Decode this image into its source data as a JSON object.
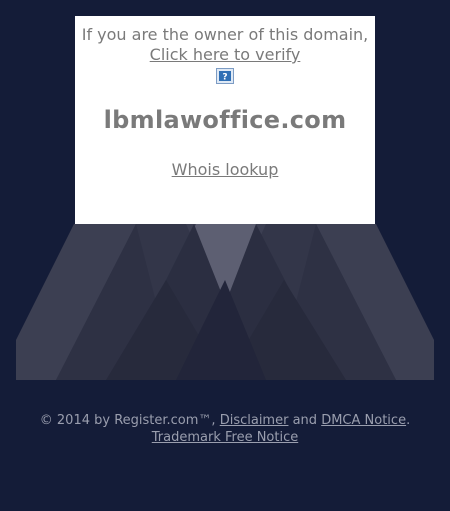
{
  "panel": {
    "owner_text": "If you are the owner of this domain,",
    "verify_link": "Click here to verify",
    "help_icon_label": "?",
    "domain": "lbmlawoffice.com",
    "whois_link": "Whois lookup"
  },
  "footer": {
    "copyright": "© 2014 by Register.com™,",
    "disclaimer": "Disclaimer",
    "and_text": "and",
    "dmca": "DMCA Notice",
    "period": ".",
    "trademark": "Trademark Free Notice"
  },
  "colors": {
    "background": "#141c38",
    "panel": "#ffffff",
    "text": "#7a7a7a",
    "footer_text": "#9a9eae"
  }
}
